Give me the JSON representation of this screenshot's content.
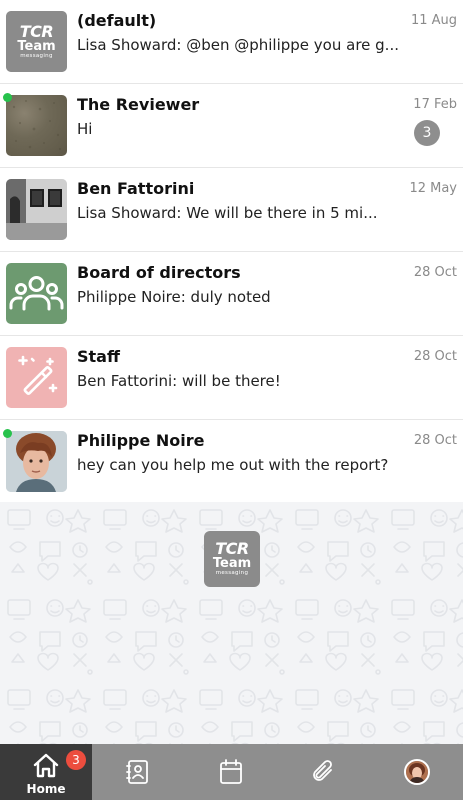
{
  "conversations": [
    {
      "name": "(default)",
      "preview": "Lisa Showard: @ben @philippe you are g...",
      "date": "11 Aug",
      "avatar_icon": "tcr-team-messaging-logo",
      "online": false,
      "unread": null
    },
    {
      "name": "The Reviewer",
      "preview": "Hi",
      "date": "17 Feb",
      "avatar_icon": "photo-texture",
      "online": true,
      "unread": "3"
    },
    {
      "name": "Ben Fattorini",
      "preview": "Lisa Showard: We will be there in 5 mi...",
      "date": "12 May",
      "avatar_icon": "photo-windows",
      "online": false,
      "unread": null
    },
    {
      "name": "Board of directors",
      "preview": "Philippe Noire: duly noted",
      "date": "28 Oct",
      "avatar_icon": "group-users-icon",
      "avatar_color": "#6d9a70",
      "online": false,
      "unread": null
    },
    {
      "name": "Staff",
      "preview": "Ben Fattorini: will be there!",
      "date": "28 Oct",
      "avatar_icon": "magic-wand-icon",
      "avatar_color": "#f0b3b3",
      "online": false,
      "unread": null
    },
    {
      "name": "Philippe Noire",
      "preview": "hey can you help me out with the report?",
      "date": "28 Oct",
      "avatar_icon": "photo-person",
      "online": true,
      "unread": null
    }
  ],
  "logo": {
    "line1": "TCR",
    "line2": "Team",
    "line3": "messaging"
  },
  "tabbar": {
    "home_label": "Home",
    "home_badge": "3",
    "items": [
      "home-icon",
      "contacts-icon",
      "calendar-icon",
      "attachment-icon",
      "profile-avatar"
    ]
  },
  "colors": {
    "online": "#27c24c",
    "badge_red": "#ec4d3e",
    "tabbar": "#8e8e8e",
    "tab_active": "#3a3a3a"
  }
}
